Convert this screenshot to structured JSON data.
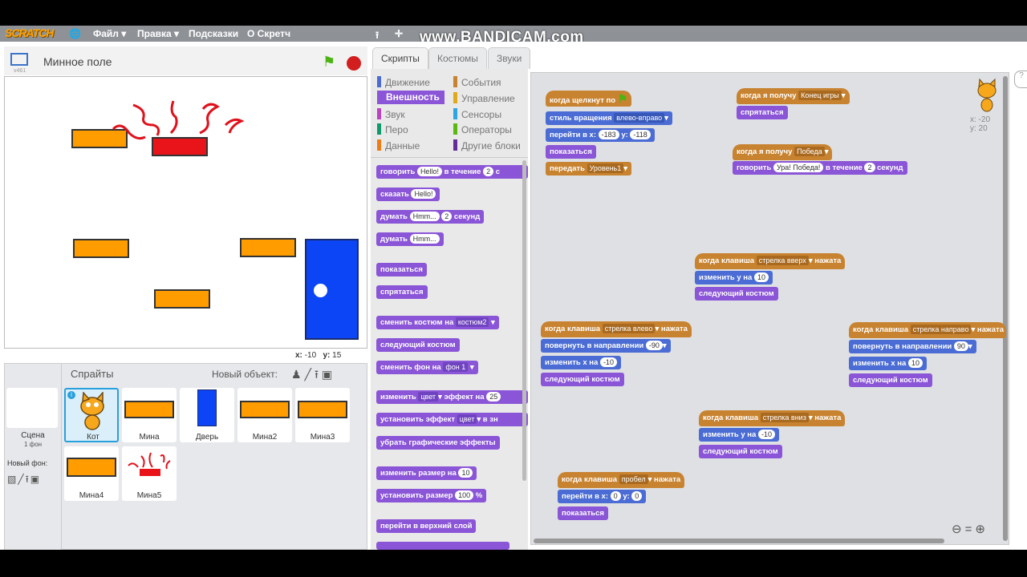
{
  "menu": {
    "logo": "SCRATCH",
    "file": "Файл ▾",
    "edit": "Правка ▾",
    "tips": "Подсказки",
    "about": "О Скретч",
    "watermark": "www.BANDICAM.com"
  },
  "stage": {
    "project_title": "Минное поле",
    "version": "v461",
    "coords": {
      "x_label": "x:",
      "x": "-10",
      "y_label": "y:",
      "y": "15"
    }
  },
  "sprites_panel": {
    "title": "Спрайты",
    "new_object": "Новый объект:",
    "stage_label": "Сцена",
    "stage_bg_count": "1 фон",
    "new_backdrop": "Новый фон:",
    "sprites": [
      {
        "name": "Кот",
        "selected": true
      },
      {
        "name": "Мина"
      },
      {
        "name": "Дверь"
      },
      {
        "name": "Мина2"
      },
      {
        "name": "Мина3"
      },
      {
        "name": "Мина4"
      },
      {
        "name": "Мина5"
      }
    ]
  },
  "tabs": {
    "scripts": "Скрипты",
    "costumes": "Костюмы",
    "sounds": "Звуки"
  },
  "categories": [
    {
      "label": "Движение",
      "color": "#4a6cd4"
    },
    {
      "label": "События",
      "color": "#c88330"
    },
    {
      "label": "Внешность",
      "color": "#8a55d7",
      "active": true
    },
    {
      "label": "Управление",
      "color": "#e1a91a"
    },
    {
      "label": "Звук",
      "color": "#bb42c3"
    },
    {
      "label": "Сенсоры",
      "color": "#2ca5e2"
    },
    {
      "label": "Перо",
      "color": "#0e9a6c"
    },
    {
      "label": "Операторы",
      "color": "#5cb712"
    },
    {
      "label": "Данные",
      "color": "#ee7d16"
    },
    {
      "label": "Другие блоки",
      "color": "#632d99"
    }
  ],
  "palette": {
    "say_for": {
      "text": "говорить",
      "val": "Hello!",
      "mid": "в течение",
      "num": "2",
      "tail": "с"
    },
    "say": {
      "text": "сказать",
      "val": "Hello!"
    },
    "think_for": {
      "text": "думать",
      "val": "Hmm...",
      "num": "2",
      "tail": "секунд"
    },
    "think": {
      "text": "думать",
      "val": "Hmm..."
    },
    "show": "показаться",
    "hide": "спрятаться",
    "switch_costume": {
      "text": "сменить костюм на",
      "dd": "костюм2"
    },
    "next_costume": "следующий костюм",
    "switch_bg": {
      "text": "сменить фон на",
      "dd": "фон 1"
    },
    "change_effect": {
      "text": "изменить",
      "dd": "цвет",
      "mid": "эффект на",
      "num": "25"
    },
    "set_effect": {
      "text": "установить эффект",
      "dd": "цвет",
      "tail": "в зн"
    },
    "clear_effects": "убрать графические эффекты",
    "change_size": {
      "text": "изменить размер на",
      "num": "10"
    },
    "set_size": {
      "text": "установить размер",
      "num": "100",
      "tail": "%"
    },
    "front": "перейти в верхний слой"
  },
  "scripts": {
    "s1": {
      "hat": "когда щелкнут по",
      "rot": "стиль вращения",
      "rot_dd": "влево-вправо",
      "goto": "перейти в x:",
      "gx": "-183",
      "gy_label": "y:",
      "gy": "-118",
      "show": "показаться",
      "bcast": "передать",
      "bcast_dd": "Уровень1"
    },
    "s2": {
      "hat": "когда я получу",
      "dd": "Конец игры",
      "body": "спрятаться"
    },
    "s3": {
      "hat": "когда я получу",
      "dd": "Победа",
      "say": "говорить",
      "say_val": "Ура! Победа!",
      "mid": "в течение",
      "num": "2",
      "tail": "секунд"
    },
    "s4": {
      "hat": "когда клавиша",
      "dd": "стрелка вверх",
      "tail": "нажата",
      "change": "изменить у на",
      "num": "10",
      "next": "следующий костюм"
    },
    "s5": {
      "hat": "когда клавиша",
      "dd": "стрелка влево",
      "tail": "нажата",
      "turn": "повернуть в направлении",
      "dir": "-90",
      "change": "изменить х на",
      "num": "-10",
      "next": "следующий костюм"
    },
    "s6": {
      "hat": "когда клавиша",
      "dd": "стрелка направо",
      "tail": "нажата",
      "turn": "повернуть в направлении",
      "dir": "90",
      "change": "изменить х на",
      "num": "10",
      "next": "следующий костюм"
    },
    "s7": {
      "hat": "когда клавиша",
      "dd": "стрелка вниз",
      "tail": "нажата",
      "change": "изменить у на",
      "num": "-10",
      "next": "следующий костюм"
    },
    "s8": {
      "hat": "когда клавиша",
      "dd": "пробел",
      "tail": "нажата",
      "goto": "перейти в x:",
      "gx": "0",
      "gy_label": "у:",
      "gy": "0",
      "show": "показаться"
    }
  },
  "sprite_info": {
    "x": "x: -20",
    "y": "y: 20"
  },
  "zoom": {
    "out": "⊖",
    "reset": "=",
    "in": "⊕"
  }
}
